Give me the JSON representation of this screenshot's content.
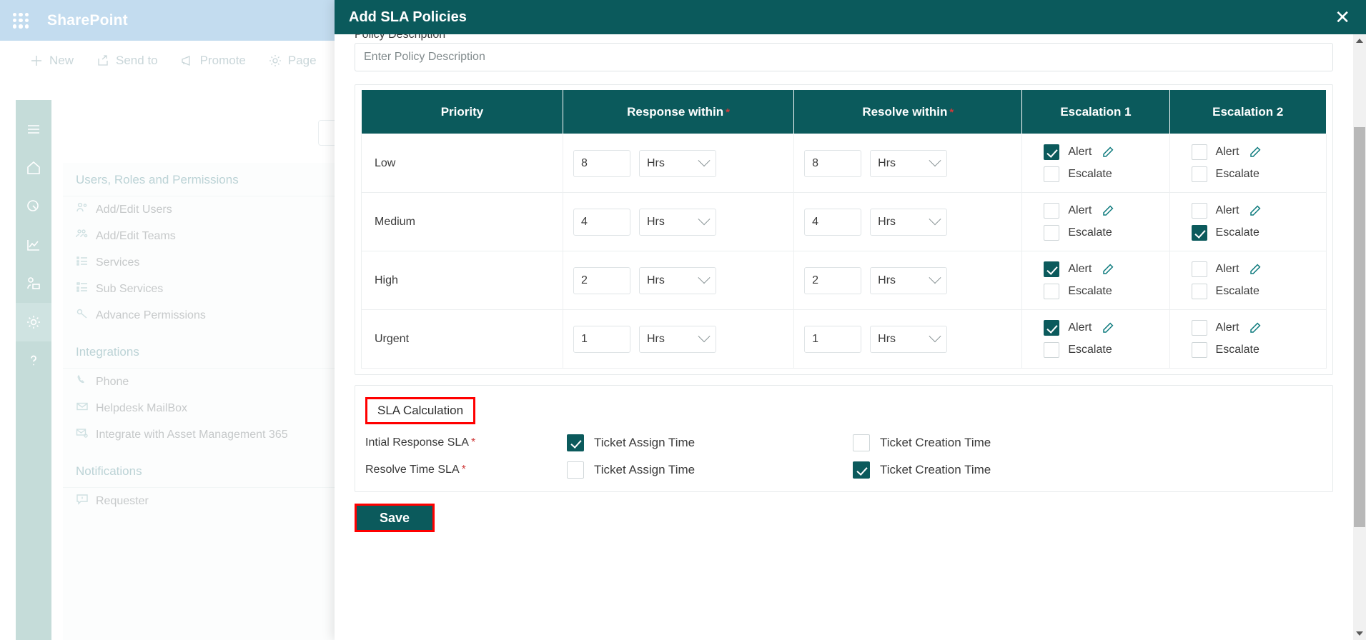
{
  "background": {
    "topbar": {
      "app_title": "SharePoint",
      "waffle_icon": "app-launcher-icon"
    },
    "commands": [
      {
        "label": "New",
        "icon": "plus-icon"
      },
      {
        "label": "Send to",
        "icon": "share-icon"
      },
      {
        "label": "Promote",
        "icon": "megaphone-icon"
      },
      {
        "label": "Page",
        "icon": "gear-icon"
      }
    ],
    "rail_icons": [
      "hamburger-icon",
      "home-icon",
      "gauge-icon",
      "chart-icon",
      "user-settings-icon",
      "gear-icon",
      "help-icon"
    ],
    "nav_groups": [
      {
        "title": "Users, Roles and Permissions",
        "items": [
          {
            "label": "Add/Edit Users",
            "icon": "users-icon"
          },
          {
            "label": "Add/Edit Teams",
            "icon": "team-icon"
          },
          {
            "label": "Services",
            "icon": "list-icon"
          },
          {
            "label": "Sub Services",
            "icon": "sublist-icon"
          },
          {
            "label": "Advance Permissions",
            "icon": "key-icon"
          }
        ]
      },
      {
        "title": "Integrations",
        "items": [
          {
            "label": "Phone",
            "icon": "phone-icon"
          },
          {
            "label": "Helpdesk MailBox",
            "icon": "mail-icon"
          },
          {
            "label": "Integrate with Asset Management 365",
            "icon": "mail-gear-icon"
          }
        ]
      },
      {
        "title": "Notifications",
        "items": [
          {
            "label": "Requester",
            "icon": "comment-alert-icon"
          }
        ]
      }
    ]
  },
  "modal": {
    "title": "Add SLA Policies",
    "close_icon": "close-icon",
    "clipped_label": "Policy Description",
    "description_placeholder": "Enter Policy Description",
    "table": {
      "columns": [
        {
          "label": "Priority",
          "required": false
        },
        {
          "label": "Response within",
          "required": true
        },
        {
          "label": "Resolve within",
          "required": true
        },
        {
          "label": "Escalation 1",
          "required": false
        },
        {
          "label": "Escalation 2",
          "required": false
        }
      ],
      "required_mark": "*",
      "alert_label": "Alert",
      "escalate_label": "Escalate",
      "edit_icon": "pencil-icon",
      "rows": [
        {
          "priority": "Low",
          "response_value": "8",
          "response_unit": "Hrs",
          "resolve_value": "8",
          "resolve_unit": "Hrs",
          "esc1_alert": true,
          "esc1_escalate": false,
          "esc2_alert": false,
          "esc2_escalate": false
        },
        {
          "priority": "Medium",
          "response_value": "4",
          "response_unit": "Hrs",
          "resolve_value": "4",
          "resolve_unit": "Hrs",
          "esc1_alert": false,
          "esc1_escalate": false,
          "esc2_alert": false,
          "esc2_escalate": true
        },
        {
          "priority": "High",
          "response_value": "2",
          "response_unit": "Hrs",
          "resolve_value": "2",
          "resolve_unit": "Hrs",
          "esc1_alert": true,
          "esc1_escalate": false,
          "esc2_alert": false,
          "esc2_escalate": false
        },
        {
          "priority": "Urgent",
          "response_value": "1",
          "response_unit": "Hrs",
          "resolve_value": "1",
          "resolve_unit": "Hrs",
          "esc1_alert": true,
          "esc1_escalate": false,
          "esc2_alert": false,
          "esc2_escalate": false
        }
      ]
    },
    "calculation": {
      "title": "SLA Calculation",
      "required_mark": "*",
      "rows": [
        {
          "label": "Intial Response SLA",
          "option1_label": "Ticket Assign Time",
          "option1_checked": true,
          "option2_label": "Ticket Creation Time",
          "option2_checked": false
        },
        {
          "label": "Resolve Time SLA",
          "option1_label": "Ticket Assign Time",
          "option1_checked": false,
          "option2_label": "Ticket Creation Time",
          "option2_checked": true
        }
      ]
    },
    "save_label": "Save"
  },
  "colors": {
    "brand_teal": "#0b5a5c",
    "sharepoint_bar": "#c3dcef",
    "highlight_red": "#ff0000",
    "required_red": "#cf3a3a",
    "rail_green": "#c5dcd9"
  }
}
